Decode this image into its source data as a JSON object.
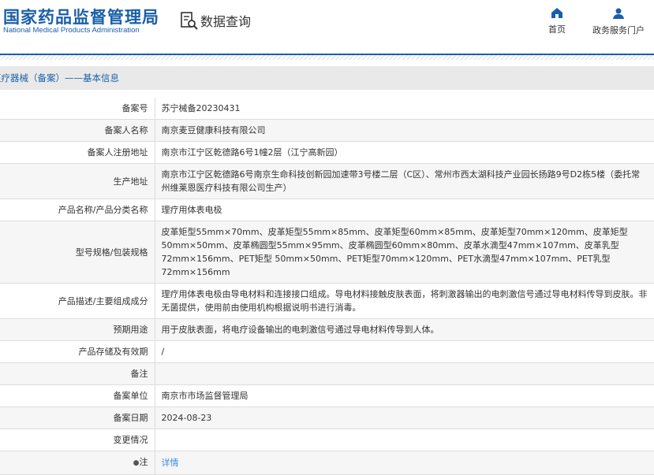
{
  "header": {
    "logo_cn": "国家药品监督管理局",
    "logo_en": "National Medical Products Administration",
    "query": "数据查询",
    "nav": [
      {
        "label": "首页",
        "icon": "home-icon"
      },
      {
        "label": "政务服务门户",
        "icon": "user-icon"
      }
    ]
  },
  "section_title": "医疗器械（备案）——基本信息",
  "rows": [
    {
      "label": "备案号",
      "value": "苏宁械备20230431"
    },
    {
      "label": "备案人名称",
      "value": "南京麦豆健康科技有限公司"
    },
    {
      "label": "备案人注册地址",
      "value": "南京市江宁区乾德路6号1幢2层（江宁高新园）"
    },
    {
      "label": "生产地址",
      "value": "南京市江宁区乾德路6号南京生命科技创新园加速带3号楼二层（C区）、常州市西太湖科技产业园长扬路9号D2栋5楼（委托常州维莱恩医疗科技有限公司生产）"
    },
    {
      "label": "产品名称/产品分类名称",
      "value": "理疗用体表电极"
    },
    {
      "label": "型号规格/包装规格",
      "value": "皮革矩型55mm×70mm、皮革矩型55mm×85mm、皮革矩型60mm×85mm、皮革矩型70mm×120mm、皮革矩型50mm×50mm、皮革椭圆型55mm×95mm、皮革椭圆型60mm×80mm、皮革水滴型47mm×107mm、皮革乳型72mm×156mm、PET矩型 50mm×50mm、PET矩型70mm×120mm、PET水滴型47mm×107mm、PET乳型72mm×156mm"
    },
    {
      "label": "产品描述/主要组成成分",
      "value": "理疗用体表电极由导电材料和连接接口组成。导电材料接触皮肤表面，将刺激器输出的电刺激信号通过导电材料传导到皮肤。非无菌提供，使用前由使用机构根据说明书进行消毒。"
    },
    {
      "label": "预期用途",
      "value": "用于皮肤表面，将电疗设备输出的电刺激信号通过导电材料传导到人体。"
    },
    {
      "label": "产品存储及有效期",
      "value": "/"
    },
    {
      "label": "备注",
      "value": ""
    },
    {
      "label": "备案单位",
      "value": "南京市市场监督管理局"
    },
    {
      "label": "备案日期",
      "value": "2024-08-23"
    },
    {
      "label": "变更情况",
      "value": ""
    },
    {
      "label": "注",
      "value": "详情"
    }
  ]
}
